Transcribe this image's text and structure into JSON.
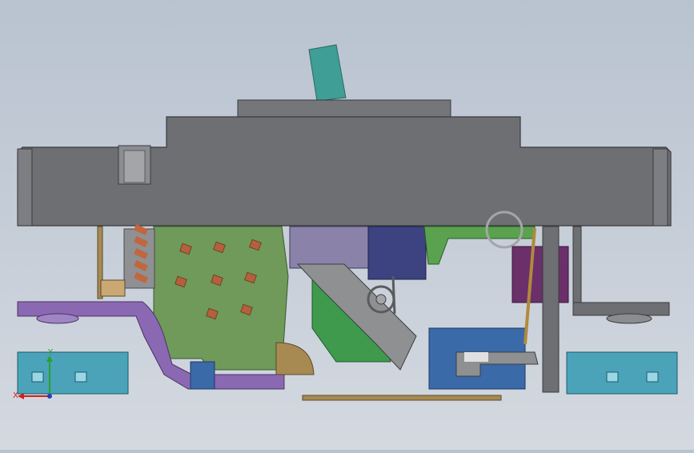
{
  "viewport": {
    "background_top": "#b9c3d0",
    "background_bottom": "#d4d9e0"
  },
  "colors": {
    "housing": "#6d6f72",
    "housing_dark": "#4a4c4f",
    "lever": "#3f9e95",
    "circuit_board": "#6f9a5a",
    "contact_pad": "#b4603c",
    "purple_link": "#8a68b2",
    "teal_block": "#4aa3b9",
    "navy_block": "#3c4380",
    "blue_block": "#3a6aa8",
    "green_part": "#3f9a4d",
    "tan_part": "#a78a52",
    "plum_part": "#6b2f6a"
  },
  "triad": {
    "x_label": "X",
    "y_label": "Y",
    "icon": "coordinate-triad-icon"
  }
}
